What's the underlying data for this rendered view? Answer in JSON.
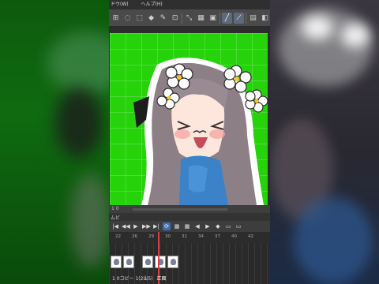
{
  "menubar": {
    "items": [
      "ドウ(W)",
      "ヘルプ(H)"
    ]
  },
  "toolbar": {
    "tools": [
      {
        "name": "ruler-tool-icon",
        "glyph": "⊞",
        "active": false
      },
      {
        "name": "lasso-icon",
        "glyph": "◌",
        "active": false
      },
      {
        "name": "selection-icon",
        "glyph": "⬚",
        "active": false
      },
      {
        "name": "fill-icon",
        "glyph": "◆",
        "active": false
      },
      {
        "name": "brush-icon",
        "glyph": "✎",
        "active": false
      },
      {
        "name": "crop-icon",
        "glyph": "⊡",
        "active": false
      },
      {
        "name": "sep",
        "glyph": "",
        "active": false
      },
      {
        "name": "transform-icon",
        "glyph": "⤡",
        "active": false
      },
      {
        "name": "grid-icon",
        "glyph": "▦",
        "active": false
      },
      {
        "name": "guide-icon",
        "glyph": "▣",
        "active": false
      },
      {
        "name": "sep",
        "glyph": "",
        "active": false
      },
      {
        "name": "line-icon",
        "glyph": "╱",
        "active": true
      },
      {
        "name": "curve-icon",
        "glyph": "⟋",
        "active": true
      },
      {
        "name": "sep",
        "glyph": "",
        "active": false
      },
      {
        "name": "panel-icon",
        "glyph": "▤",
        "active": false
      },
      {
        "name": "eraser-icon",
        "glyph": "◧",
        "active": false
      }
    ]
  },
  "status": {
    "zoom": "1 0"
  },
  "timeline": {
    "title": "ムビ",
    "controls": [
      "|◀",
      "◀◀",
      "▶",
      "▶▶",
      "▶|",
      "⟳",
      "▦",
      "▦",
      "◀",
      "▶",
      "◆",
      "▭",
      "▭"
    ],
    "ruler": [
      "22",
      "26",
      "29",
      "30",
      "31",
      "34",
      "37",
      "40",
      "42"
    ],
    "label": "1 0コピー 1(2出5)",
    "label2": "正面"
  },
  "colors": {
    "canvas": "#26d30b",
    "playhead": "#e23b3b"
  }
}
